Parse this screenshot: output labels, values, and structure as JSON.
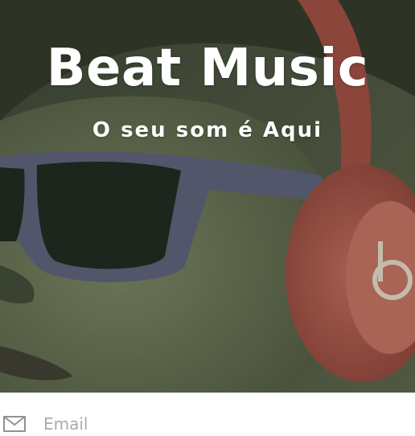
{
  "hero": {
    "title": "Beat Music",
    "subtitle": "O seu som é Aqui",
    "image_description_icon": "headphones-photo"
  },
  "form": {
    "email": {
      "icon": "mail-icon",
      "placeholder": "Email",
      "value": ""
    }
  },
  "colors": {
    "overlay": "#4a503f",
    "headphone": "#b8554b",
    "text_on_image": "#ffffff",
    "placeholder": "#a7abae"
  }
}
